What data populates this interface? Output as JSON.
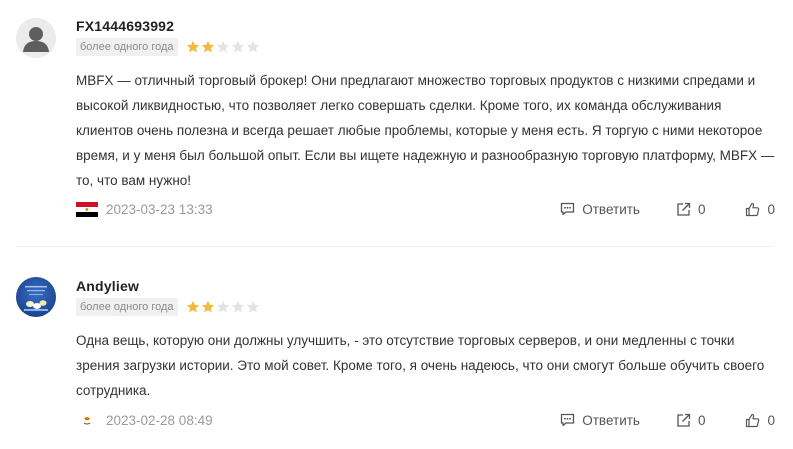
{
  "reviews": [
    {
      "username": "FX1444693992",
      "duration": "более одного года",
      "rating": 2,
      "max_rating": 5,
      "text": "MBFX — отличный торговый брокер! Они предлагают множество торговых продуктов с низкими спредами и высокой ликвидностью, что позволяет легко совершать сделки. Кроме того, их команда обслуживания клиентов очень полезна и всегда решает любые проблемы, которые у меня есть. Я торгую с ними некоторое время, и у меня был большой опыт. Если вы ищете надежную и разнообразную торговую платформу, MBFX — то, что вам нужно!",
      "date": "2023-03-23 13:33",
      "flag_icon": "egypt-flag-icon",
      "reply_label": "Ответить",
      "share_count": "0",
      "like_count": "0"
    },
    {
      "username": "Andyliew",
      "duration": "более одного года",
      "rating": 2,
      "max_rating": 5,
      "text": "Одна вещь, которую они должны улучшить, - это отсутствие торговых серверов, и они медленны с точки зрения загрузки истории. Это мой совет. Кроме того, я очень надеюсь, что они смогут больше обучить своего сотрудника.",
      "date": "2023-02-28 08:49",
      "flag_icon": "cyprus-flag-icon",
      "reply_label": "Ответить",
      "share_count": "0",
      "like_count": "0"
    }
  ],
  "colors": {
    "star_filled": "#F5B93F",
    "star_empty": "#E4E4E4",
    "badge_bg": "#F0F0F0",
    "badge_text": "#8A8A8A",
    "date_text": "#9A9A9A"
  }
}
